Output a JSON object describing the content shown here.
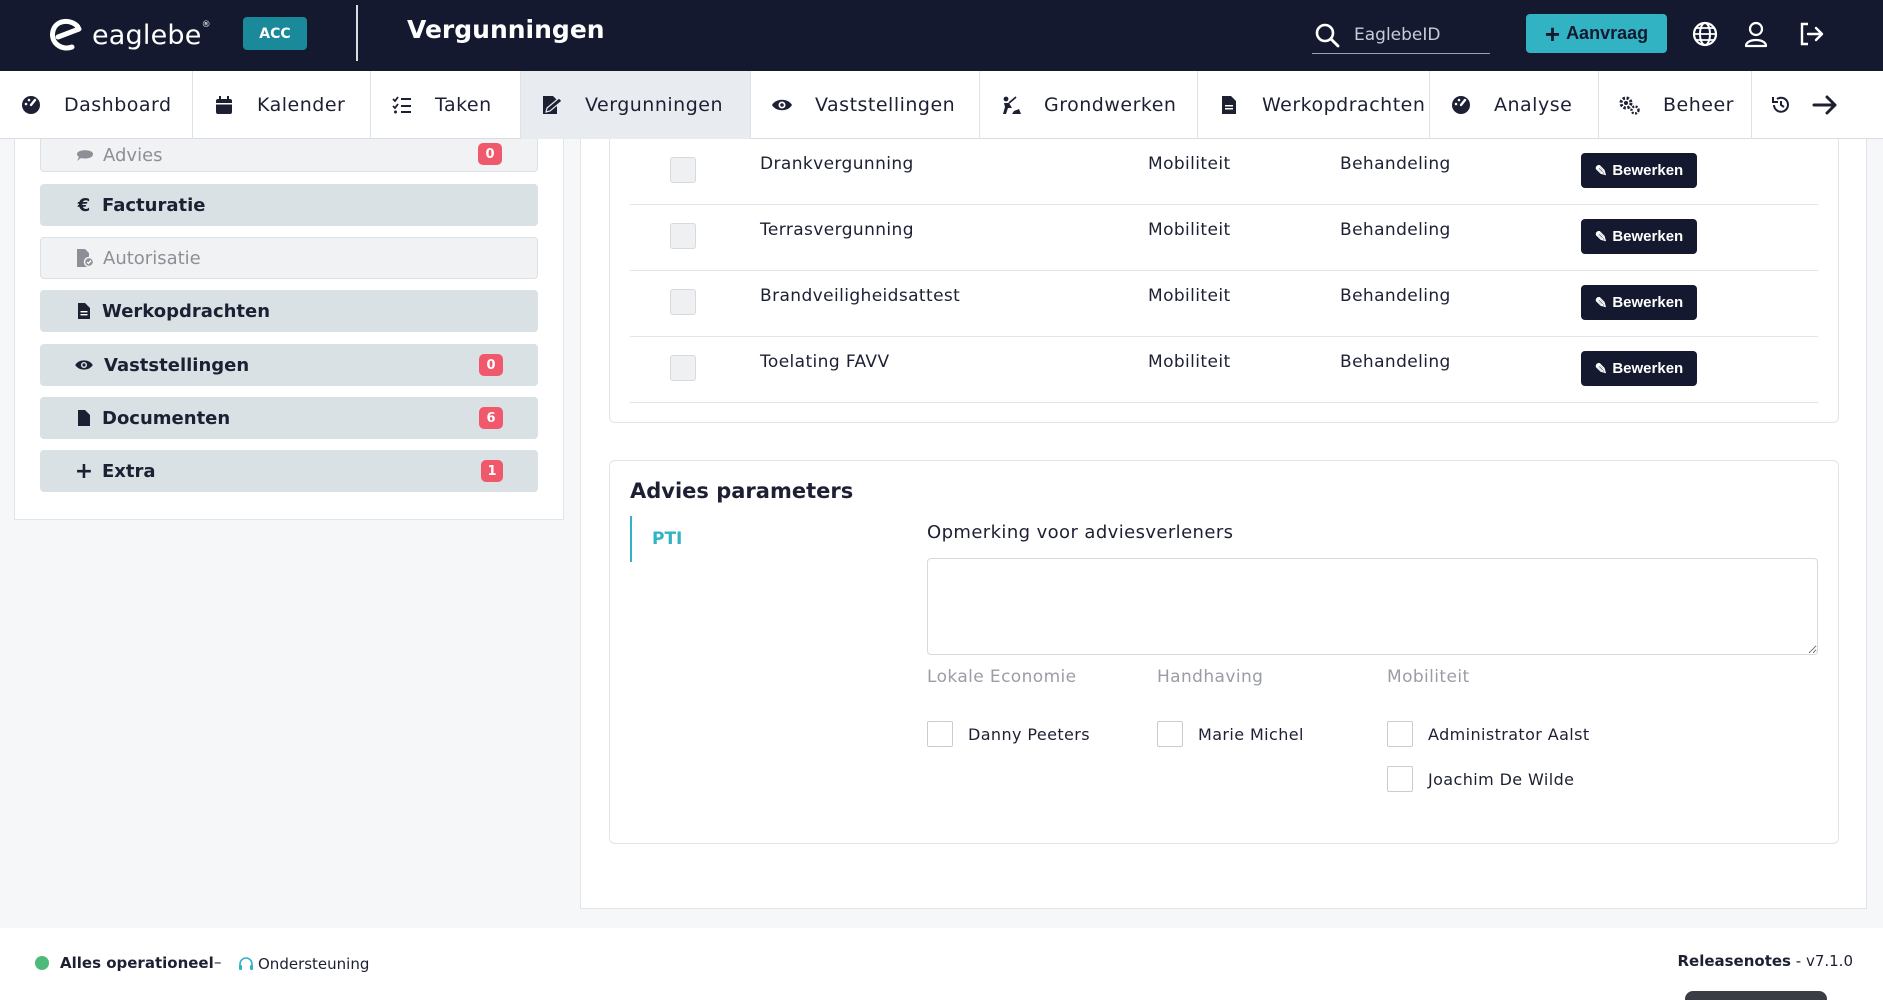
{
  "header": {
    "logo_text": "eaglebe",
    "env_badge": "ACC",
    "page_title": "Vergunningen",
    "search_placeholder": "EaglebeID",
    "new_button_label": "Aanvraag",
    "icons": [
      "search-icon",
      "globe-icon",
      "user-icon",
      "logout-icon"
    ]
  },
  "nav": {
    "tabs": [
      {
        "label": "Dashboard",
        "icon": "dashboard-icon",
        "active": false
      },
      {
        "label": "Kalender",
        "icon": "calendar-icon",
        "active": false
      },
      {
        "label": "Taken",
        "icon": "tasks-icon",
        "active": false
      },
      {
        "label": "Vergunningen",
        "icon": "permit-icon",
        "active": true
      },
      {
        "label": "Vaststellingen",
        "icon": "eye-icon",
        "active": false
      },
      {
        "label": "Grondwerken",
        "icon": "digging-icon",
        "active": false
      },
      {
        "label": "Werkopdrachten",
        "icon": "document-icon",
        "active": false
      },
      {
        "label": "Analyse",
        "icon": "gauge-icon",
        "active": false
      },
      {
        "label": "Beheer",
        "icon": "cogs-icon",
        "active": false
      }
    ],
    "extra_icons": [
      "history-icon",
      "arrow-right-icon"
    ]
  },
  "sidebar": {
    "items": [
      {
        "label": "Advies",
        "badge": "0",
        "style": "muted"
      },
      {
        "label": "Facturatie",
        "badge": "",
        "style": "normal"
      },
      {
        "label": "Autorisatie",
        "badge": "",
        "style": "muted"
      },
      {
        "label": "Werkopdrachten",
        "badge": "",
        "style": "normal"
      },
      {
        "label": "Vaststellingen",
        "badge": "0",
        "style": "normal"
      },
      {
        "label": "Documenten",
        "badge": "6",
        "style": "normal"
      },
      {
        "label": "Extra",
        "badge": "1",
        "style": "normal"
      }
    ],
    "euro_symbol": "€",
    "plus_symbol": "+"
  },
  "permits_table": {
    "edit_label": "Bewerken",
    "rows": [
      {
        "name": "Drankvergunning",
        "domain": "Mobiliteit",
        "status": "Behandeling"
      },
      {
        "name": "Terrasvergunning",
        "domain": "Mobiliteit",
        "status": "Behandeling"
      },
      {
        "name": "Brandveiligheidsattest",
        "domain": "Mobiliteit",
        "status": "Behandeling"
      },
      {
        "name": "Toelating FAVV",
        "domain": "Mobiliteit",
        "status": "Behandeling"
      }
    ]
  },
  "advies": {
    "title": "Advies parameters",
    "tab": "PTI",
    "remark_label": "Opmerking voor adviesverleners",
    "remark_value": "",
    "groups": [
      {
        "label": "Lokale Economie",
        "people": [
          "Danny Peeters"
        ]
      },
      {
        "label": "Handhaving",
        "people": [
          "Marie Michel"
        ]
      },
      {
        "label": "Mobiliteit",
        "people": [
          "Administrator Aalst",
          "Joachim De Wilde"
        ]
      }
    ]
  },
  "footer": {
    "status": "Alles operationeel",
    "separator": "–",
    "support": "Ondersteuning",
    "release_label": "Releasenotes",
    "release_version": " - v7.1.0"
  },
  "colors": {
    "header_bg": "#14192f",
    "accent": "#31b3c4",
    "badge": "#f0596b",
    "status_ok": "#4cbb7a"
  }
}
